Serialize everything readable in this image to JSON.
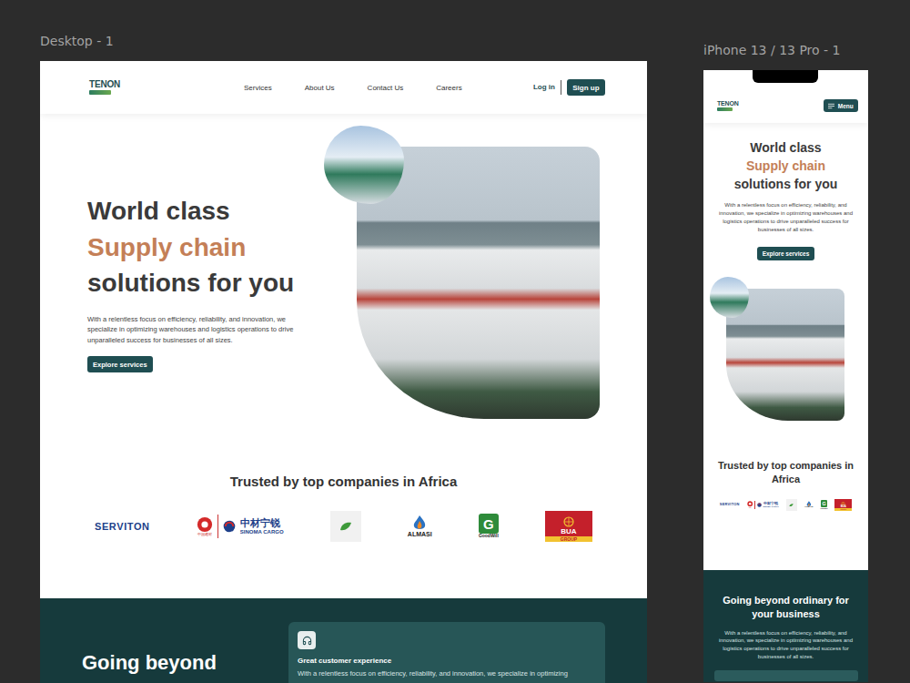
{
  "canvas": {
    "frames": [
      {
        "label": "Desktop - 1"
      },
      {
        "label": "iPhone 13 / 13 Pro - 1"
      }
    ]
  },
  "site": {
    "logo": {
      "name": "TENON"
    },
    "nav": [
      "Services",
      "About Us",
      "Contact Us",
      "Careers"
    ],
    "login": "Log in",
    "signup": "Sign up",
    "menu": "Menu",
    "hero": {
      "line1": "World class",
      "accent": "Supply chain",
      "line3": "solutions for you",
      "body": "With a relentless focus on efficiency, reliability, and innovation, we specialize in optimizing warehouses and logistics operations to drive unparalleled success for businesses of all sizes.",
      "cta": "Explore services"
    },
    "trusted": {
      "title": "Trusted by top companies in Africa",
      "logos": [
        {
          "kind": "serviton",
          "text": "SERVITON"
        },
        {
          "kind": "sinoma",
          "mark": "中国建材",
          "text": "中材宁锐",
          "sub": "SINOMA CARGO"
        },
        {
          "kind": "leaf"
        },
        {
          "kind": "almasi",
          "text": "ALMASI"
        },
        {
          "kind": "goodwill",
          "mark": "G",
          "text": "GoodWill"
        },
        {
          "kind": "bua",
          "text": "BUA",
          "sub": "GROUP"
        }
      ]
    },
    "features": {
      "title_desktop": "Going beyond",
      "title_mobile": "Going beyond ordinary for your business",
      "body": "With a relentless focus on efficiency, reliability, and innovation, we specialize in optimizing warehouses and logistics operations to drive unparalleled success for businesses of all sizes.",
      "card": {
        "title": "Great customer experience",
        "body": "With a relentless focus on efficiency, reliability, and innovation, we specialize in optimizing"
      }
    }
  }
}
